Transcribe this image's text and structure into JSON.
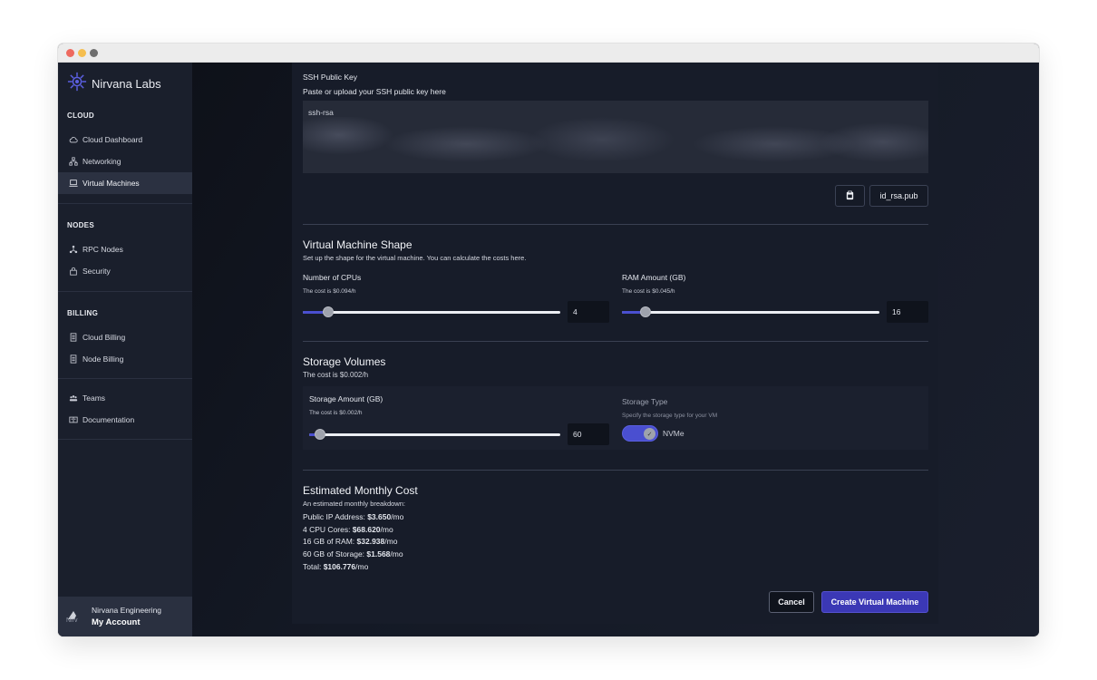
{
  "window": {
    "controls": [
      "close",
      "minimize",
      "zoom"
    ]
  },
  "sidebar": {
    "brand": "Nirvana Labs",
    "sections": {
      "cloud": "CLOUD",
      "nodes": "NODES",
      "billing": "BILLING"
    },
    "items": [
      {
        "label": "Cloud Dashboard",
        "icon": "cloud-icon"
      },
      {
        "label": "Networking",
        "icon": "network-icon"
      },
      {
        "label": "Virtual Machines",
        "icon": "laptop-icon",
        "active": true
      },
      {
        "label": "RPC Nodes",
        "icon": "nodes-icon"
      },
      {
        "label": "Security",
        "icon": "lock-icon"
      },
      {
        "label": "Cloud Billing",
        "icon": "receipt-icon"
      },
      {
        "label": "Node Billing",
        "icon": "receipt-icon"
      },
      {
        "label": "Teams",
        "icon": "team-icon"
      },
      {
        "label": "Documentation",
        "icon": "book-icon"
      }
    ],
    "account": {
      "org": "Nirvana Engineering",
      "label": "My Account",
      "avatar_alt": "Nirv"
    }
  },
  "ssh": {
    "title": "SSH Public Key",
    "subtitle": "Paste or upload your SSH public key here",
    "value": "ssh-rsa",
    "file_label": "id_rsa.pub"
  },
  "shape": {
    "title": "Virtual Machine Shape",
    "subtitle": "Set up the shape for the virtual machine. You can calculate the costs here.",
    "cpu": {
      "label": "Number of CPUs",
      "cost": "The cost is $0.094/h",
      "value": "4",
      "fraction": 0.06
    },
    "ram": {
      "label": "RAM Amount (GB)",
      "cost": "The cost is $0.045/h",
      "value": "16",
      "fraction": 0.05
    }
  },
  "storage": {
    "title": "Storage Volumes",
    "cost": "The cost is $0.002/h",
    "amount": {
      "label": "Storage Amount (GB)",
      "cost": "The cost is $0.002/h",
      "value": "60",
      "fraction": 0.0
    },
    "type": {
      "label": "Storage Type",
      "hint": "Specify the storage type for your VM",
      "value": "NVMe",
      "enabled": true
    }
  },
  "estimate": {
    "title": "Estimated Monthly Cost",
    "subtitle": "An estimated monthly breakdown:",
    "lines": [
      {
        "label": "Public IP Address: ",
        "amount": "$3.650",
        "unit": "/mo"
      },
      {
        "label": "4 CPU Cores: ",
        "amount": "$68.620",
        "unit": "/mo"
      },
      {
        "label": "16 GB of RAM: ",
        "amount": "$32.938",
        "unit": "/mo"
      },
      {
        "label": "60 GB of Storage: ",
        "amount": "$1.568",
        "unit": "/mo"
      },
      {
        "label": "Total: ",
        "amount": "$106.776",
        "unit": "/mo"
      }
    ]
  },
  "actions": {
    "cancel": "Cancel",
    "create": "Create Virtual Machine"
  },
  "colors": {
    "accent": "#4a4fd0",
    "primary_button": "#3b38b5",
    "sidebar_bg": "#1a1f2c",
    "panel_bg": "#171c29"
  }
}
